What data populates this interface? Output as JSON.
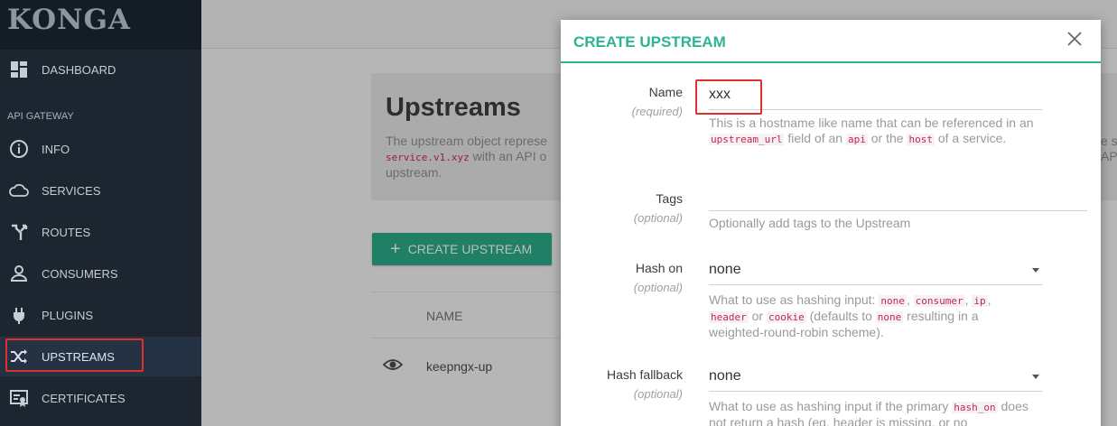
{
  "app": {
    "brand": "KONGA"
  },
  "sidebar": {
    "dashboard_label": "DASHBOARD",
    "section_label": "API GATEWAY",
    "items": [
      {
        "label": "INFO",
        "icon": "info-icon"
      },
      {
        "label": "SERVICES",
        "icon": "cloud-icon"
      },
      {
        "label": "ROUTES",
        "icon": "routes-icon"
      },
      {
        "label": "CONSUMERS",
        "icon": "user-icon"
      },
      {
        "label": "PLUGINS",
        "icon": "plug-icon"
      },
      {
        "label": "UPSTREAMS",
        "icon": "shuffle-icon"
      },
      {
        "label": "CERTIFICATES",
        "icon": "certificate-icon"
      }
    ],
    "active_item": "UPSTREAMS"
  },
  "page": {
    "title": "Upstreams",
    "description_start": "The upstream object represe",
    "description_code": "service.v1.xyz",
    "description_mid": " with an API o",
    "description_end": "upstream.",
    "right_fragment_1": "e s",
    "right_fragment_2": "AP",
    "create_button": "CREATE UPSTREAM"
  },
  "table": {
    "column_name": "NAME",
    "rows": [
      {
        "name": "keepngx-up"
      }
    ]
  },
  "modal": {
    "title": "CREATE UPSTREAM",
    "name": {
      "label": "Name",
      "sub": "(required)",
      "value": "xxx",
      "help": [
        {
          "t": "This is a hostname like name that can be referenced in an "
        },
        {
          "c": "upstream_url"
        },
        {
          "t": " field of an "
        },
        {
          "c": "api"
        },
        {
          "t": " or the "
        },
        {
          "c": "host"
        },
        {
          "t": " of a service."
        }
      ]
    },
    "tags": {
      "label": "Tags",
      "sub": "(optional)",
      "value": "",
      "help": "Optionally add tags to the Upstream"
    },
    "hash_on": {
      "label": "Hash on",
      "sub": "(optional)",
      "value": "none",
      "help": [
        {
          "t": "What to use as hashing input: "
        },
        {
          "c": "none"
        },
        {
          "t": ", "
        },
        {
          "c": "consumer"
        },
        {
          "t": ", "
        },
        {
          "c": "ip"
        },
        {
          "t": ", "
        },
        {
          "c": "header"
        },
        {
          "t": " or "
        },
        {
          "c": "cookie"
        },
        {
          "t": " (defaults to "
        },
        {
          "c": "none"
        },
        {
          "t": " resulting in a weighted-round-robin scheme)."
        }
      ]
    },
    "hash_fallback": {
      "label": "Hash fallback",
      "sub": "(optional)",
      "value": "none",
      "help": [
        {
          "t": "What to use as hashing input if the primary "
        },
        {
          "c": "hash_on"
        },
        {
          "t": " does not return a hash (eg. header is missing, or no"
        }
      ]
    }
  },
  "colors": {
    "accent": "#2fb493",
    "button": "#2aa382",
    "highlight": "#e0302a",
    "sidebar_bg": "#1c2530",
    "code": "#c7254e"
  }
}
